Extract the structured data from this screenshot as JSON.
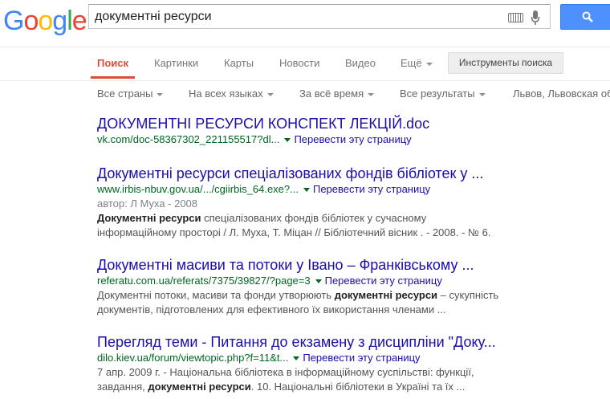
{
  "logo": {
    "letters": [
      "G",
      "o",
      "o",
      "g",
      "l",
      "e"
    ],
    "colors": [
      "#4285f4",
      "#ea4335",
      "#fbbc05",
      "#4285f4",
      "#34a853",
      "#ea4335"
    ]
  },
  "search": {
    "query": "документні ресурси"
  },
  "nav": {
    "tabs": [
      "Поиск",
      "Картинки",
      "Карты",
      "Новости",
      "Видео"
    ],
    "more_label": "Ещё",
    "tools_label": "Инструменты поиска"
  },
  "filters": [
    "Все страны",
    "На всех языках",
    "За всё время",
    "Все результаты",
    "Львов, Львовская об"
  ],
  "results": [
    {
      "title": "ДОКУМЕНТНІ РЕСУРСИ КОНСПЕКТ ЛЕКЦІЙ.doc",
      "url": "vk.com/doc-58367302_221155517?dl...",
      "translate": "Перевести эту страницу",
      "meta": "",
      "snippet_lines": []
    },
    {
      "title": "Документні ресурси спеціалізованих фондів бібліотек у ...",
      "url": "www.irbis-nbuv.gov.ua/.../cgiirbis_64.exe?...",
      "translate": "Перевести эту страницу",
      "meta": "автор: Л Муха - 2008",
      "snippet_lines": [
        [
          {
            "t": "Документні ресурси",
            "b": true
          },
          {
            "t": " спеціалізованих фондів бібліотек у сучасному",
            "b": false
          }
        ],
        [
          {
            "t": "інформаційному просторі / Л. Муха, Т. Міцан // Бібліотечний вісник . - 2008. - № 6.",
            "b": false
          }
        ]
      ]
    },
    {
      "title": "Документні масиви та потоки у Івано – Франківському ...",
      "url": "referatu.com.ua/referats/7375/39827/?page=3",
      "translate": "Перевести эту страницу",
      "meta": "",
      "snippet_lines": [
        [
          {
            "t": "Документні потоки, масиви та фонди утворюють ",
            "b": false
          },
          {
            "t": "документні ресурси",
            "b": true
          },
          {
            "t": " – сукупність",
            "b": false
          }
        ],
        [
          {
            "t": "документів, підготовлених для ефективного їх використання членами ...",
            "b": false
          }
        ]
      ]
    },
    {
      "title": "Перегляд теми - Питання до екзамену з дисципліни \"Доку...",
      "url": "dilo.kiev.ua/forum/viewtopic.php?f=11&t...",
      "translate": "Перевести эту страницу",
      "meta": "",
      "snippet_lines": [
        [
          {
            "t": "7 апр. 2009 г. - Національна бібліотека в інформаційному суспільстві: функції,",
            "b": false
          }
        ],
        [
          {
            "t": "завдання, ",
            "b": false
          },
          {
            "t": "документні ресурси",
            "b": true
          },
          {
            "t": ". 10. Національні бібліотеки в Україні та їх ...",
            "b": false
          }
        ]
      ]
    }
  ]
}
